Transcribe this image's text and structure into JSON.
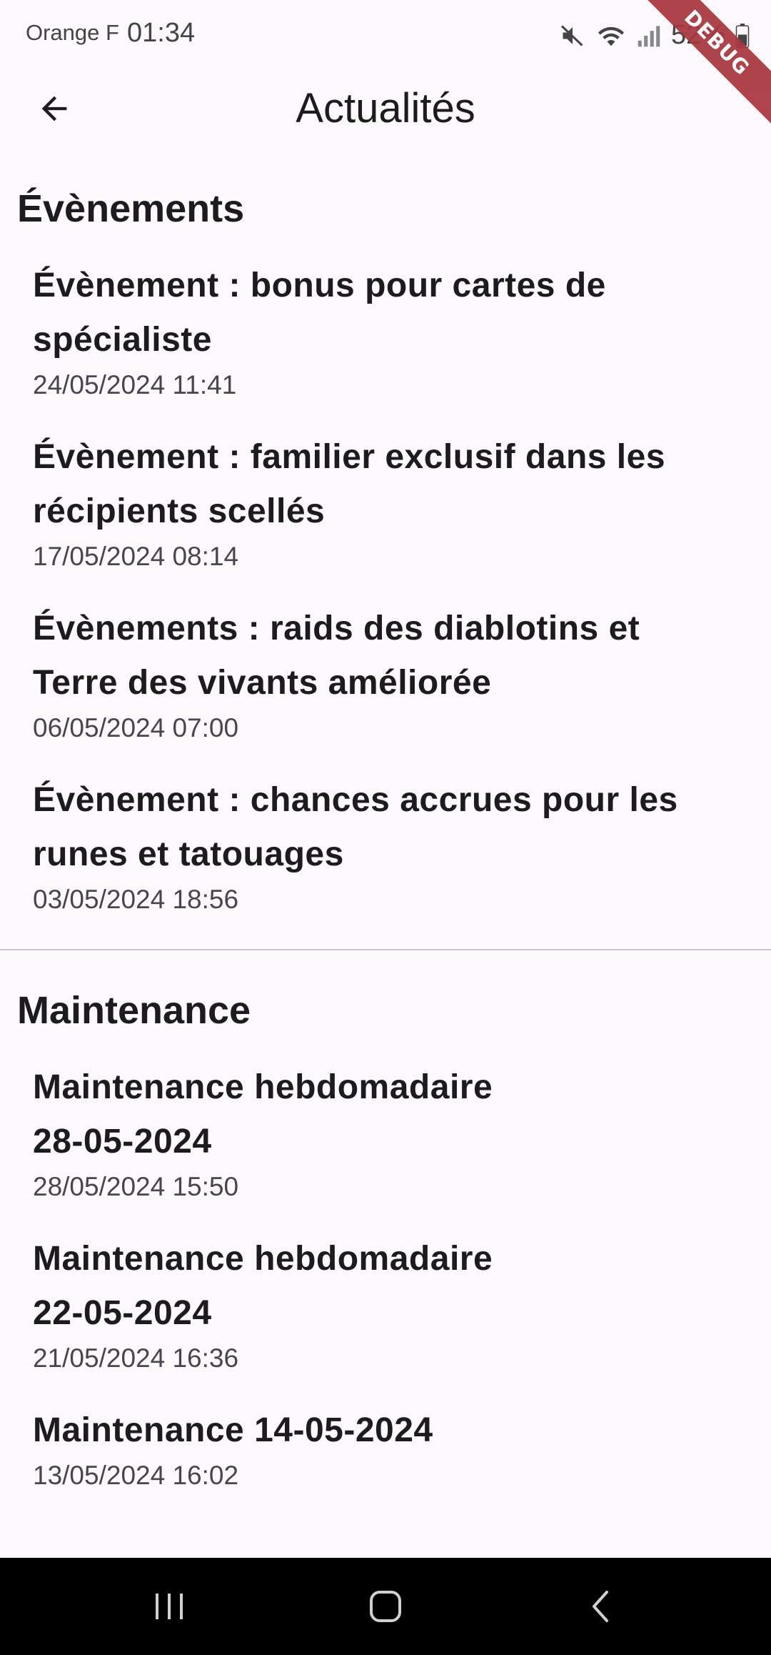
{
  "status_bar": {
    "carrier": "Orange F",
    "time": "01:34",
    "battery": "52%",
    "debug_label": "DEBUG"
  },
  "app_bar": {
    "title": "Actualités",
    "back_icon": "arrow-back-icon"
  },
  "sections": [
    {
      "title": "Évènements",
      "items": [
        {
          "title": "Évènement : bonus pour cartes de spécialiste",
          "date": "24/05/2024 11:41"
        },
        {
          "title": "Évènement : familier exclusif dans les récipients scellés",
          "date": "17/05/2024 08:14"
        },
        {
          "title": "Évènements : raids des diablotins et Terre des vivants améliorée",
          "date": "06/05/2024 07:00"
        },
        {
          "title": "Évènement : chances accrues pour les runes et tatouages",
          "date": "03/05/2024 18:56"
        }
      ]
    },
    {
      "title": "Maintenance",
      "items": [
        {
          "title": "Maintenance hebdomadaire 28-05-2024",
          "date": "28/05/2024 15:50"
        },
        {
          "title": "Maintenance hebdomadaire 22-05-2024",
          "date": "21/05/2024 16:36"
        },
        {
          "title": "Maintenance 14-05-2024",
          "date": "13/05/2024 16:02"
        }
      ]
    }
  ],
  "nav_bar": {
    "recents_icon": "recent-apps-icon",
    "home_icon": "home-icon",
    "back_icon": "back-nav-icon"
  }
}
